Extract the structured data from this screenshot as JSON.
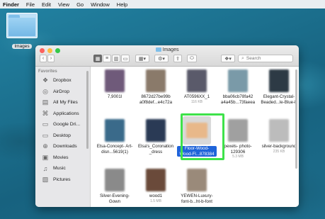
{
  "menubar": {
    "app": "Finder",
    "items": [
      "File",
      "Edit",
      "View",
      "Go",
      "Window",
      "Help"
    ]
  },
  "desktop": {
    "folder_label": "Images"
  },
  "window": {
    "title": "Images",
    "search_placeholder": "Search"
  },
  "sidebar": {
    "heading": "Favorites",
    "items": [
      {
        "label": "Dropbox",
        "icon": "dropbox-icon"
      },
      {
        "label": "AirDrop",
        "icon": "airdrop-icon"
      },
      {
        "label": "All My Files",
        "icon": "all-files-icon"
      },
      {
        "label": "Applications",
        "icon": "applications-icon"
      },
      {
        "label": "Google Dri...",
        "icon": "google-drive-icon"
      },
      {
        "label": "Desktop",
        "icon": "desktop-icon"
      },
      {
        "label": "Downloads",
        "icon": "downloads-icon"
      },
      {
        "label": "Movies",
        "icon": "movies-icon"
      },
      {
        "label": "Music",
        "icon": "music-icon"
      },
      {
        "label": "Pictures",
        "icon": "pictures-icon"
      }
    ]
  },
  "files": [
    {
      "name": "7,9001l",
      "size": "",
      "color": "#6f5a7a"
    },
    {
      "name": "8672d27be99b a0f8def...e4c72a",
      "size": "",
      "color": "#8a7a6a"
    },
    {
      "name": "AT0596XX_1",
      "size": "116 KB",
      "color": "#5a5a6a"
    },
    {
      "name": "bba06cb78fa42 a4a45b...73faeea",
      "size": "",
      "color": "#7a9aa8"
    },
    {
      "name": "Elegant-Crystal- Beaded...le-Blue-b",
      "size": "",
      "color": "#2d3a45"
    },
    {
      "name": "Elsa-Concept- Art-disn...5619(1)",
      "size": "",
      "color": "#3a6a8a"
    },
    {
      "name": "Elsa's_Coronation _dress",
      "size": "",
      "color": "#2a3a55"
    },
    {
      "name": "Floor-Wood- Wood-Fl...878384",
      "size": "",
      "color": "#e8b88a",
      "selected": true
    },
    {
      "name": "pexels- photo-129306",
      "size": "5.3 MB",
      "color": "#a0a0a0"
    },
    {
      "name": "silver-background",
      "size": "235 KB",
      "color": "#bcbcbc"
    },
    {
      "name": "Silver-Evening- Gown",
      "size": "",
      "color": "#8a8a8a"
    },
    {
      "name": "wood1",
      "size": "1.5 MB",
      "color": "#6a4a3a"
    },
    {
      "name": "YEWEN-Luxury- font-b...ht-b-font",
      "size": "",
      "color": "#9a8a7a"
    }
  ]
}
